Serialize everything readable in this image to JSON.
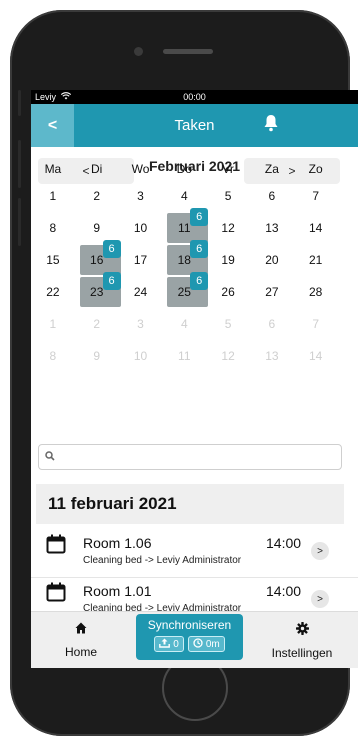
{
  "status_bar": {
    "carrier": "Leviy",
    "time": "00:00"
  },
  "navbar": {
    "back": "<",
    "title": "Taken"
  },
  "calendar": {
    "month_title": "Februari 2021",
    "prev": "<",
    "next": ">",
    "weekdays": [
      "Ma",
      "Di",
      "Wo",
      "Do",
      "Vr",
      "Za",
      "Zo"
    ],
    "weeks": [
      [
        {
          "d": "1"
        },
        {
          "d": "2"
        },
        {
          "d": "3"
        },
        {
          "d": "4"
        },
        {
          "d": "5"
        },
        {
          "d": "6"
        },
        {
          "d": "7"
        }
      ],
      [
        {
          "d": "8"
        },
        {
          "d": "9"
        },
        {
          "d": "10"
        },
        {
          "d": "11",
          "tasks": "6"
        },
        {
          "d": "12"
        },
        {
          "d": "13"
        },
        {
          "d": "14"
        }
      ],
      [
        {
          "d": "15"
        },
        {
          "d": "16",
          "tasks": "6"
        },
        {
          "d": "17"
        },
        {
          "d": "18",
          "tasks": "6"
        },
        {
          "d": "19"
        },
        {
          "d": "20"
        },
        {
          "d": "21"
        }
      ],
      [
        {
          "d": "22"
        },
        {
          "d": "23",
          "tasks": "6"
        },
        {
          "d": "24"
        },
        {
          "d": "25",
          "tasks": "6"
        },
        {
          "d": "26"
        },
        {
          "d": "27"
        },
        {
          "d": "28"
        }
      ],
      [
        {
          "d": "1",
          "dim": true
        },
        {
          "d": "2",
          "dim": true
        },
        {
          "d": "3",
          "dim": true
        },
        {
          "d": "4",
          "dim": true
        },
        {
          "d": "5",
          "dim": true
        },
        {
          "d": "6",
          "dim": true
        },
        {
          "d": "7",
          "dim": true
        }
      ],
      [
        {
          "d": "8",
          "dim": true
        },
        {
          "d": "9",
          "dim": true
        },
        {
          "d": "10",
          "dim": true
        },
        {
          "d": "11",
          "dim": true
        },
        {
          "d": "12",
          "dim": true
        },
        {
          "d": "13",
          "dim": true
        },
        {
          "d": "14",
          "dim": true
        }
      ]
    ]
  },
  "search": {
    "placeholder": ""
  },
  "day": {
    "title": "11 februari 2021",
    "tasks": [
      {
        "room": "Room 1.06",
        "desc": "Cleaning bed -> Leviy Administrator",
        "time": "14:00",
        "chevron": ">"
      },
      {
        "room": "Room 1.01",
        "desc": "Cleaning bed -> Leviy Administrator",
        "time": "14:00",
        "chevron": ">"
      }
    ]
  },
  "tabbar": {
    "home": "Home",
    "sync_title": "Synchroniseren",
    "sync_upload": "0",
    "sync_time": "0m",
    "settings": "Instellingen"
  },
  "colors": {
    "accent": "#1f97b0",
    "task_bg": "#9aa3a5"
  }
}
